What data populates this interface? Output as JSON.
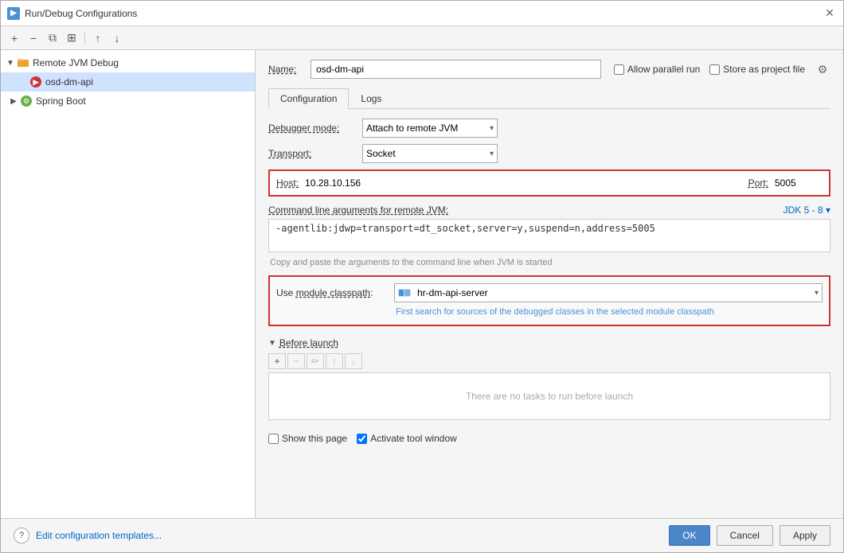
{
  "window": {
    "title": "Run/Debug Configurations"
  },
  "toolbar": {
    "add_label": "+",
    "remove_label": "−",
    "copy_label": "⧉",
    "move_up_label": "↑",
    "move_down_label": "↓"
  },
  "tree": {
    "remote_jvm": {
      "label": "Remote JVM Debug",
      "expanded": true,
      "children": [
        {
          "label": "osd-dm-api",
          "selected": true
        }
      ]
    },
    "spring_boot": {
      "label": "Spring Boot",
      "expanded": false
    }
  },
  "config": {
    "name_label": "Name:",
    "name_value": "osd-dm-api",
    "allow_parallel_label": "Allow parallel run",
    "store_as_project_label": "Store as project file",
    "tabs": [
      "Configuration",
      "Logs"
    ],
    "active_tab": "Configuration",
    "debugger_mode_label": "Debugger mode:",
    "debugger_mode_value": "Attach to remote JVM",
    "transport_label": "Transport:",
    "transport_value": "Socket",
    "host_label": "Host:",
    "host_value": "10.28.10.156",
    "port_label": "Port:",
    "port_value": "5005",
    "cmd_label": "Command line arguments for remote JVM:",
    "jdk_label": "JDK 5 - 8 ▾",
    "cmd_value": "-agentlib:jdwp=transport=dt_socket,server=y,suspend=n,address=5005",
    "cmd_hint": "Copy and paste the arguments to the command line when JVM is started",
    "module_label": "Use module classpath:",
    "module_value": "hr-dm-api-server",
    "module_hint": "First search for sources of the debugged classes in the selected module classpath",
    "before_launch_title": "Before launch",
    "before_launch_empty": "There are no tasks to run before launch",
    "show_page_label": "Show this page",
    "activate_tool_label": "Activate tool window"
  },
  "footer": {
    "help_label": "?",
    "edit_templates_label": "Edit configuration templates...",
    "ok_label": "OK",
    "cancel_label": "Cancel",
    "apply_label": "Apply"
  }
}
